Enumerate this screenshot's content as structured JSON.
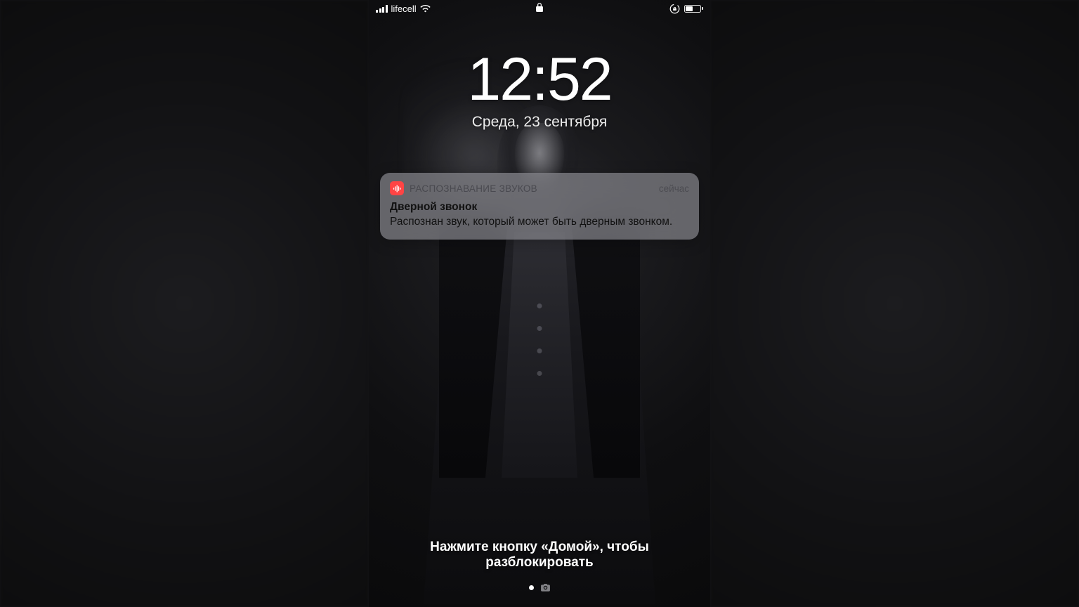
{
  "status": {
    "carrier": "lifecell",
    "battery_percent": 45
  },
  "lockscreen": {
    "time": "12:52",
    "date": "Среда, 23 сентября",
    "unlock_hint": "Нажмите кнопку «Домой», чтобы разблокировать"
  },
  "notification": {
    "app_name": "РАСПОЗНАВАНИЕ ЗВУКОВ",
    "timestamp": "сейчас",
    "title": "Дверной звонок",
    "body": "Распознан звук, который может быть дверным звонком.",
    "icon": "sound-recognition-icon",
    "icon_color": "#f44"
  }
}
